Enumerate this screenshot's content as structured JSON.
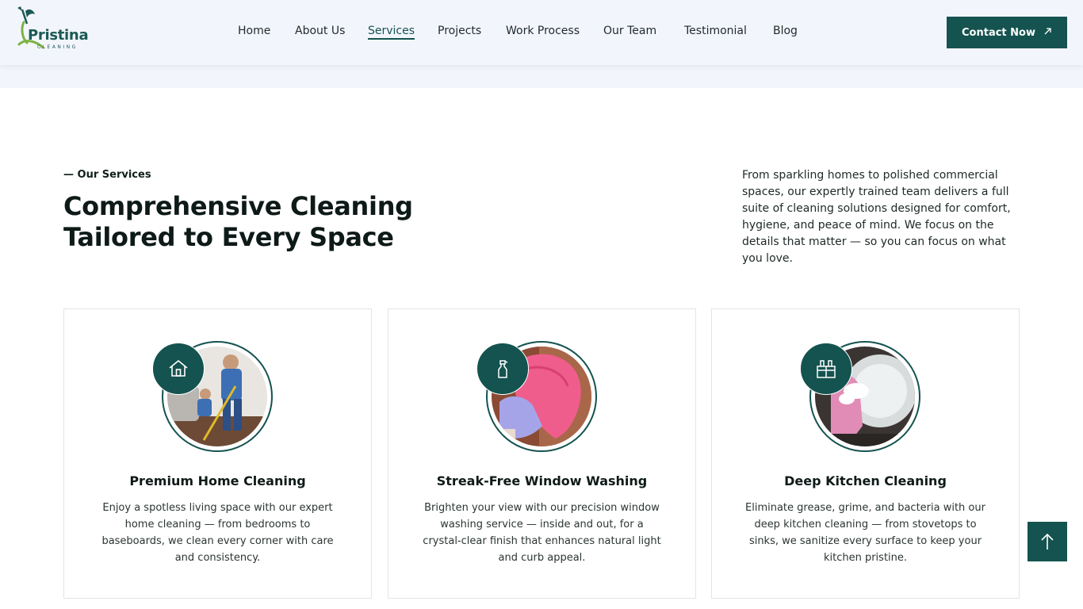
{
  "brand": {
    "name": "Pristina",
    "tagline": "CLEANING"
  },
  "nav": {
    "items": [
      {
        "label": "Home"
      },
      {
        "label": "About Us"
      },
      {
        "label": "Services",
        "active": true
      },
      {
        "label": "Projects"
      },
      {
        "label": "Work Process"
      },
      {
        "label": "Our Team"
      },
      {
        "label": "Testimonial"
      },
      {
        "label": "Blog"
      }
    ]
  },
  "header": {
    "cta_label": "Contact Now",
    "cta_icon": "arrow-up-right-icon"
  },
  "services": {
    "eyebrow": "— Our Services",
    "title_line1": "Comprehensive Cleaning",
    "title_line2": "Tailored to Every Space",
    "intro": "From sparkling homes to polished commercial spaces, our expertly trained team delivers a full suite of cleaning solutions designed for comfort, hygiene, and peace of mind. We focus on the details that matter — so you can focus on what you love.",
    "cards": [
      {
        "icon": "house-icon",
        "title": "Premium Home Cleaning",
        "text": "Enjoy a spotless living space with our expert home cleaning — from bedrooms to baseboards, we clean every corner with care and consistency."
      },
      {
        "icon": "spray-bottle-icon",
        "title": "Streak-Free Window Washing",
        "text": "Brighten your view with our precision window washing service — inside and out, for a crystal-clear finish that enhances natural light and curb appeal."
      },
      {
        "icon": "kitchen-counter-icon",
        "title": "Deep Kitchen Cleaning",
        "text": "Eliminate grease, grime, and bacteria with our deep kitchen cleaning — from stovetops to sinks, we sanitize every surface to keep your kitchen pristine."
      }
    ]
  },
  "back_to_top": {
    "icon": "arrow-up-icon"
  },
  "colors": {
    "primary": "#14534f",
    "header_bg": "#f3f5fd",
    "text": "#0e1a18"
  }
}
